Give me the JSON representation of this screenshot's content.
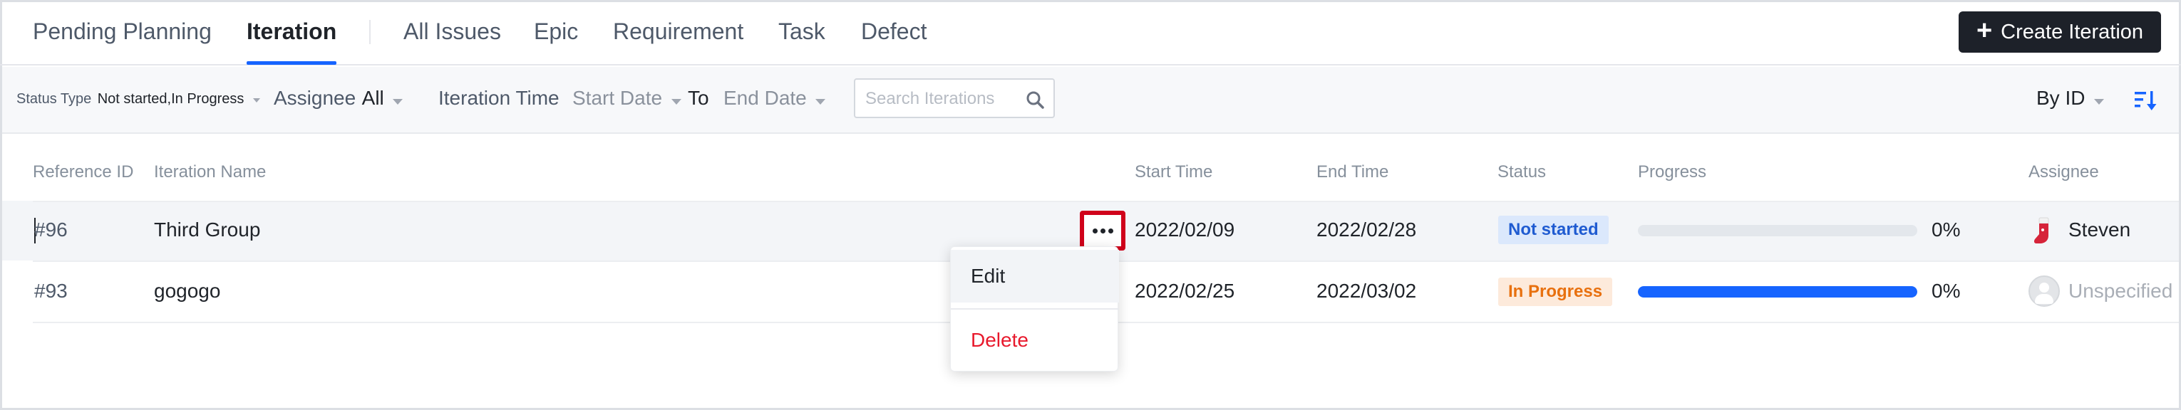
{
  "nav": {
    "tabs": [
      {
        "label": "Pending Planning"
      },
      {
        "label": "Iteration",
        "active": true
      },
      {
        "label": "All Issues"
      },
      {
        "label": "Epic"
      },
      {
        "label": "Requirement"
      },
      {
        "label": "Task"
      },
      {
        "label": "Defect"
      }
    ],
    "create_button": "Create Iteration",
    "create_icon": "plus-icon"
  },
  "filters": {
    "status_label": "Status Type",
    "status_value": "Not started,In Progress",
    "assignee_label": "Assignee",
    "assignee_value": "All",
    "time_label": "Iteration Time",
    "start_placeholder": "Start Date",
    "to_label": "To",
    "end_placeholder": "End Date",
    "search_placeholder": "Search Iterations",
    "sort_label": "By ID",
    "sort_icon": "sort-descending-icon"
  },
  "table": {
    "columns": [
      "Reference ID",
      "Iteration Name",
      "Start Time",
      "End Time",
      "Status",
      "Progress",
      "Assignee"
    ],
    "rows": [
      {
        "ref": "#96",
        "name": "Third Group",
        "start": "2022/02/09",
        "end": "2022/02/28",
        "status": "Not started",
        "progress_text": "0%",
        "progress_fill": 0,
        "assignee": "Steven",
        "assignee_icon": "sock-avatar-icon"
      },
      {
        "ref": "#93",
        "name": "gogogo",
        "start": "2022/02/25",
        "end": "2022/03/02",
        "status": "In Progress",
        "progress_text": "0%",
        "progress_fill": 1,
        "assignee": "Unspecified",
        "assignee_icon": "empty-user-avatar-icon"
      }
    ]
  },
  "context_menu": {
    "items": [
      "Edit",
      "Delete"
    ]
  },
  "colors": {
    "accent": "#1664ff",
    "create_button_bg": "#1d2129",
    "not_started_bg": "#dbe8fc",
    "not_started_text": "#1f5bd1",
    "in_progress_bg": "#fdeadb",
    "in_progress_text": "#e8700e",
    "delete_text": "#e8192c",
    "highlight_border": "#d0021b"
  }
}
